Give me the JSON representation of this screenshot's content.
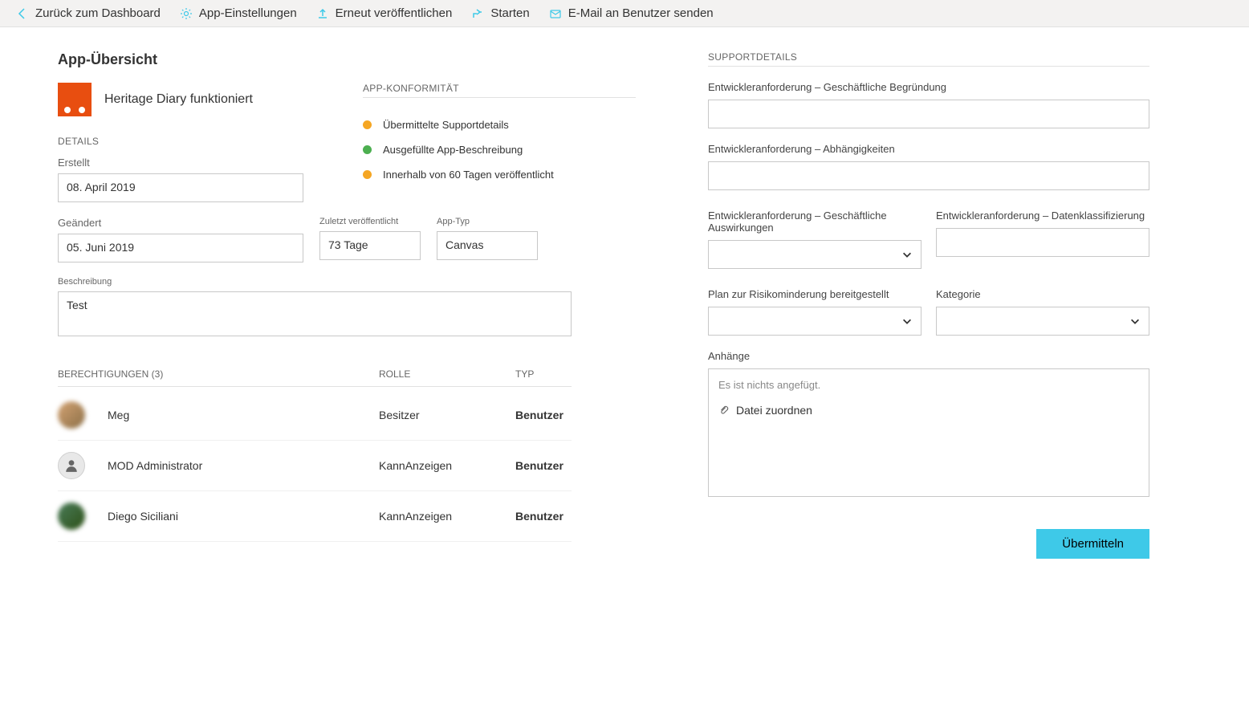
{
  "toolbar": {
    "back": "Zurück zum Dashboard",
    "settings": "App-Einstellungen",
    "republish": "Erneut veröffentlichen",
    "start": "Starten",
    "email": "E-Mail an Benutzer senden"
  },
  "overview": {
    "title": "App-Übersicht",
    "app_name": "Heritage Diary funktioniert",
    "details_label": "DETAILS",
    "created_label": "Erstellt",
    "created_value": "08. April 2019",
    "modified_label": "Geändert",
    "modified_value": "05. Juni 2019",
    "lastpub_label": "Zuletzt veröffentlicht",
    "lastpub_value": "73 Tage",
    "apptype_label": "App-Typ",
    "apptype_value": "Canvas",
    "description_label": "Beschreibung",
    "description_value": "Test"
  },
  "compliance": {
    "title": "APP-KONFORMITÄT",
    "items": [
      {
        "status": "orange",
        "text": "Übermittelte Supportdetails"
      },
      {
        "status": "green",
        "text": "Ausgefüllte App-Beschreibung"
      },
      {
        "status": "orange",
        "text": "Innerhalb von 60 Tagen veröffentlicht"
      }
    ]
  },
  "permissions": {
    "title": "BERECHTIGUNGEN (3)",
    "col_role": "ROLLE",
    "col_type": "TYP",
    "rows": [
      {
        "name": "Meg",
        "role": "Besitzer",
        "type": "Benutzer",
        "avatar": "photo"
      },
      {
        "name": "MOD Administrator",
        "role": "KannAnzeigen",
        "type": "Benutzer",
        "avatar": "default"
      },
      {
        "name": "Diego Siciliani",
        "role": "KannAnzeigen",
        "type": "Benutzer",
        "avatar": "photo"
      }
    ]
  },
  "support": {
    "title": "SUPPORTDETAILS",
    "business_justification": "Entwickleranforderung – Geschäftliche Begründung",
    "dependencies": "Entwickleranforderung – Abhängigkeiten",
    "business_impact": "Entwickleranforderung – Geschäftliche Auswirkungen",
    "data_classification": "Entwickleranforderung – Datenklassifizierung",
    "risk_mitigation": "Plan zur Risikominderung bereitgestellt",
    "category": "Kategorie",
    "attachments": "Anhänge",
    "attachments_empty": "Es ist nichts angefügt.",
    "attach_file": "Datei zuordnen"
  },
  "submit": "Übermitteln"
}
